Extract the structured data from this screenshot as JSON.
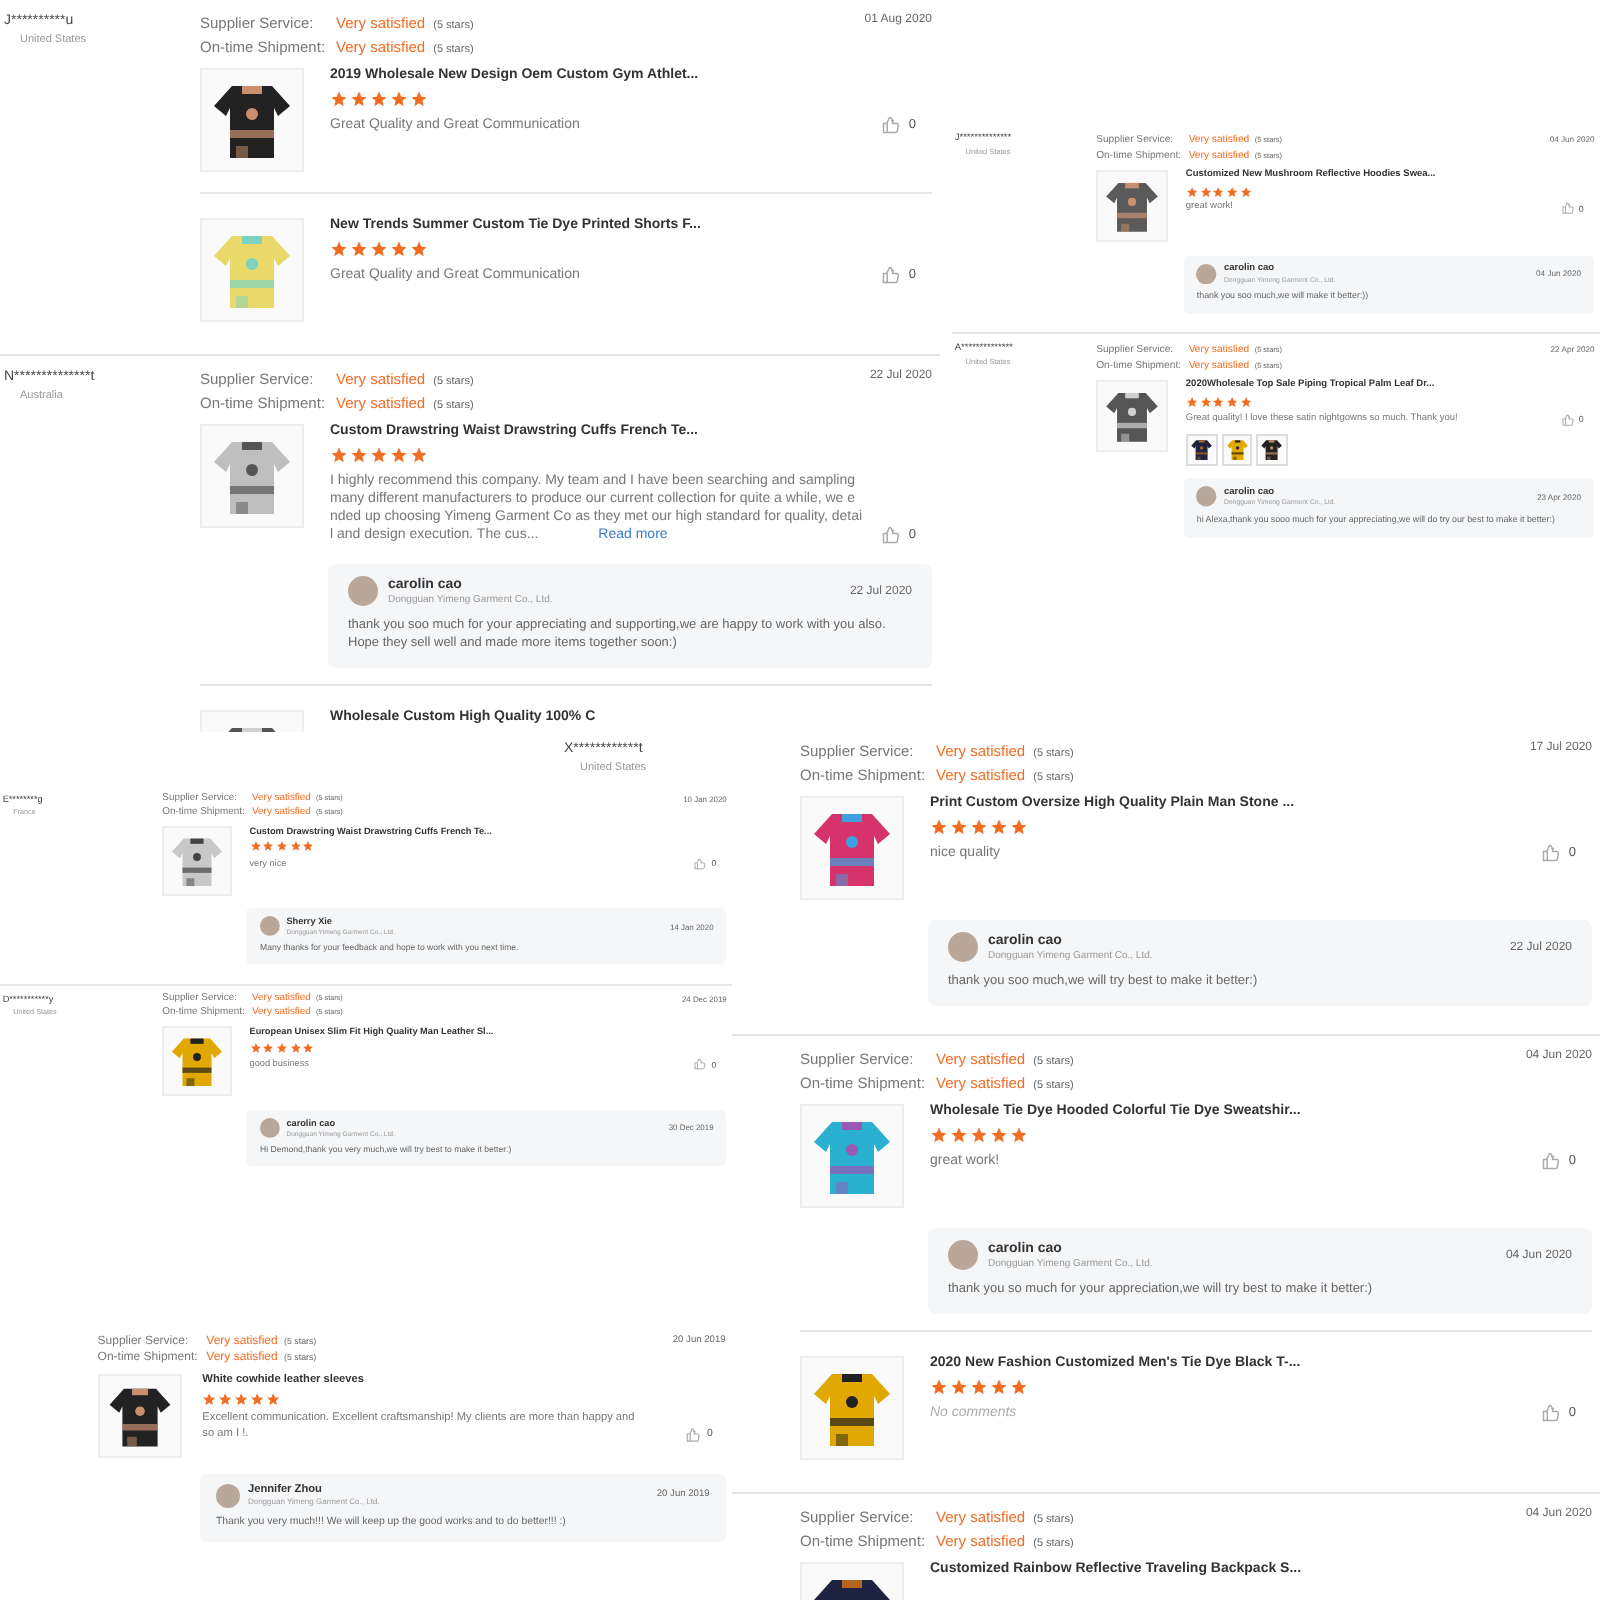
{
  "panels": [
    {
      "reviews": [
        {
          "buyer": {
            "name": "J**********u",
            "country": "United States"
          },
          "ratings": [
            {
              "label": "Supplier Service:",
              "value": "Very satisfied",
              "note": "(5 stars)"
            },
            {
              "label": "On-time Shipment:",
              "value": "Very satisfied",
              "note": "(5 stars)"
            }
          ],
          "date": "01 Aug 2020",
          "items": [
            {
              "product": "2019 Wholesale New Design Oem Custom Gym Athlet...",
              "stars": 5,
              "comment": "Great Quality and Great Communication",
              "placeholder": false,
              "likes": "0"
            },
            {
              "product": "New Trends Summer Custom Tie Dye Printed Shorts F...",
              "stars": 5,
              "comment": "Great Quality and Great Communication",
              "placeholder": false,
              "likes": "0"
            }
          ]
        },
        {
          "buyer": {
            "name": "N**************t",
            "country": "Australia"
          },
          "ratings": [
            {
              "label": "Supplier Service:",
              "value": "Very satisfied",
              "note": "(5 stars)"
            },
            {
              "label": "On-time Shipment:",
              "value": "Very satisfied",
              "note": "(5 stars)"
            }
          ],
          "date": "22 Jul 2020",
          "items": [
            {
              "product": "Custom Drawstring Waist Drawstring Cuffs French Te...",
              "stars": 5,
              "comment": "I highly recommend this company. My team and I have been searching and sampling many different manufacturers to produce our current collection for quite a while, we ended up choosing Yimeng Garment Co as they met our high standard for quality, detail and design execution. The cus...",
              "placeholder": false,
              "read_more": "Read more",
              "likes": "0"
            }
          ],
          "reply": {
            "name": "carolin cao",
            "company": "Dongguan Yimeng Garment Co., Ltd.",
            "date": "22 Jul 2020",
            "text": "thank you soo much for your appreciating and supporting,we are happy to work with you also. Hope they sell well and made more items together soon:)"
          },
          "after_items": [
            {
              "product": "Wholesale Custom High Quality 100% C"
            }
          ]
        }
      ]
    },
    {
      "reviews": [
        {
          "buyer": {
            "name": "J**************",
            "country": "United States"
          },
          "ratings": [
            {
              "label": "Supplier Service:",
              "value": "Very satisfied",
              "note": "(5 stars)"
            },
            {
              "label": "On-time Shipment:",
              "value": "Very satisfied",
              "note": "(5 stars)"
            }
          ],
          "date": "04 Jun 2020",
          "items": [
            {
              "product": "Customized New Mushroom Reflective Hoodies Swea...",
              "stars": 5,
              "comment": "great work!",
              "placeholder": false,
              "likes": "0"
            }
          ],
          "reply": {
            "name": "carolin cao",
            "company": "Dongguan Yimeng Garment Co., Ltd.",
            "date": "04 Jun 2020",
            "text": "thank you soo much,we will make it better:))"
          }
        },
        {
          "buyer": {
            "name": "A**************",
            "country": "United States"
          },
          "ratings": [
            {
              "label": "Supplier Service:",
              "value": "Very satisfied",
              "note": "(5 stars)"
            },
            {
              "label": "On-time Shipment:",
              "value": "Very satisfied",
              "note": "(5 stars)"
            }
          ],
          "date": "22 Apr 2020",
          "items": [
            {
              "product": "2020Wholesale Top Sale Piping Tropical Palm Leaf Dr...",
              "stars": 5,
              "comment": "Great quality! I love these satin nightgowns so much. Thank you!",
              "placeholder": false,
              "likes": "0",
              "photos": [
                {
                  "kind": "picture"
                },
                {
                  "kind": "picture"
                },
                {
                  "kind": "picture"
                }
              ]
            }
          ],
          "reply": {
            "name": "carolin cao",
            "company": "Dongguan Yimeng Garment Co., Ltd.",
            "date": "23 Apr 2020",
            "text": "hi Alexa,thank you sooo much for your appreciating,we will do try our best to make it better:)"
          }
        }
      ]
    },
    {
      "reviews": [
        {
          "buyer": {
            "name": "X************t",
            "country": "United States"
          },
          "ratings": [
            {
              "label": "Supplier Service:",
              "value": "Very satisfied",
              "note": "(5 stars)"
            },
            {
              "label": "On-time Shipment:",
              "value": "Very satisfied",
              "note": "(5 stars)"
            }
          ],
          "date": "17 Jul 2020",
          "items": [
            {
              "product": "Print Custom Oversize High Quality Plain Man Stone ...",
              "stars": 5,
              "comment": "nice quality",
              "placeholder": false,
              "likes": "0"
            }
          ],
          "reply": {
            "name": "carolin cao",
            "company": "Dongguan Yimeng Garment Co., Ltd.",
            "date": "22 Jul 2020",
            "text": "thank you soo much,we will try best to make it better:)"
          }
        },
        {
          "ratings": [
            {
              "label": "Supplier Service:",
              "value": "Very satisfied",
              "note": "(5 stars)"
            },
            {
              "label": "On-time Shipment:",
              "value": "Very satisfied",
              "note": "(5 stars)"
            }
          ],
          "date": "04 Jun 2020",
          "items": [
            {
              "product": "Wholesale Tie Dye Hooded Colorful Tie Dye Sweatshir...",
              "stars": 5,
              "comment": "great work!",
              "placeholder": false,
              "likes": "0"
            }
          ],
          "reply": {
            "name": "carolin cao",
            "company": "Dongguan Yimeng Garment Co., Ltd.",
            "date": "04 Jun 2020",
            "text": "thank you so much for your appreciation,we will try best to make it better:)"
          },
          "after_items": [
            {
              "product": "2020 New Fashion Customized Men's Tie Dye Black T-...",
              "stars": 5,
              "comment": "No comments",
              "placeholder": true,
              "likes": "0"
            }
          ]
        },
        {
          "ratings": [
            {
              "label": "Supplier Service:",
              "value": "Very satisfied",
              "note": "(5 stars)"
            },
            {
              "label": "On-time Shipment:",
              "value": "Very satisfied",
              "note": "(5 stars)"
            }
          ],
          "date": "04 Jun 2020",
          "items": [
            {
              "product": "Customized Rainbow Reflective Traveling Backpack S..."
            }
          ]
        }
      ]
    },
    {
      "reviews": [
        {
          "buyer": {
            "name": "E********g",
            "country": "France"
          },
          "ratings": [
            {
              "label": "Supplier Service:",
              "value": "Very satisfied",
              "note": "(5 stars)"
            },
            {
              "label": "On-time Shipment:",
              "value": "Very satisfied",
              "note": "(5 stars)"
            }
          ],
          "date": "10 Jan 2020",
          "items": [
            {
              "product": "Custom Drawstring Waist Drawstring Cuffs French Te...",
              "stars": 5,
              "comment": "very nice",
              "placeholder": false,
              "likes": "0"
            }
          ],
          "reply": {
            "name": "Sherry Xie",
            "company": "Dongguan Yimeng Garment Co., Ltd.",
            "date": "14 Jan 2020",
            "text": "Many thanks for your feedback and hope to work with you next time."
          }
        },
        {
          "buyer": {
            "name": "D***********y",
            "country": "United States"
          },
          "ratings": [
            {
              "label": "Supplier Service:",
              "value": "Very satisfied",
              "note": "(5 stars)"
            },
            {
              "label": "On-time Shipment:",
              "value": "Very satisfied",
              "note": "(5 stars)"
            }
          ],
          "date": "24 Dec 2019",
          "items": [
            {
              "product": "European Unisex Slim Fit High Quality Man Leather Sl...",
              "stars": 5,
              "comment": "good business",
              "placeholder": false,
              "likes": "0"
            }
          ],
          "reply": {
            "name": "carolin cao",
            "company": "Dongguan Yimeng Garment Co., Ltd.",
            "date": "30 Dec 2019",
            "text": "Hi Demond,thank you very much,we will try best to make it better:)"
          }
        }
      ]
    },
    {
      "reviews": [
        {
          "ratings": [
            {
              "label": "Supplier Service:",
              "value": "Very satisfied",
              "note": "(5 stars)"
            },
            {
              "label": "On-time Shipment:",
              "value": "Very satisfied",
              "note": "(5 stars)"
            }
          ],
          "date": "20 Jun 2019",
          "items": [
            {
              "product": "White cowhide leather sleeves",
              "stars": 5,
              "comment": "Excellent communication. Excellent craftsmanship! My clients are more than happy and so am I !.",
              "placeholder": false,
              "likes": "0"
            }
          ],
          "reply": {
            "name": "Jennifer Zhou",
            "company": "Dongguan Yimeng Garment Co., Ltd.",
            "date": "20 Jun 2019",
            "text": "Thank you very much!!! We will keep up the good works and to do better!!! :)"
          }
        }
      ]
    }
  ]
}
